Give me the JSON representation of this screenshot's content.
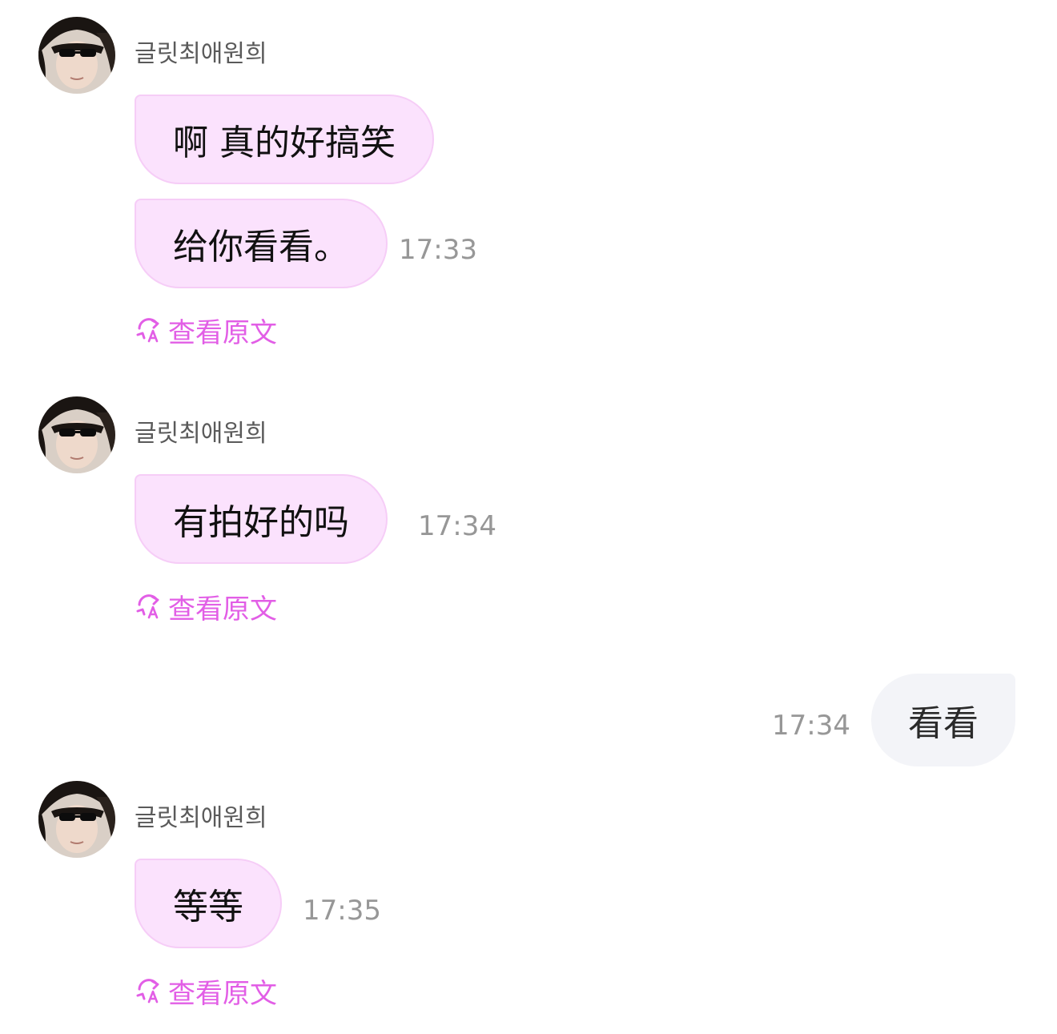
{
  "colors": {
    "incoming_bubble": "#fbe2fd",
    "incoming_border": "#f6cdf7",
    "outgoing_bubble": "#f3f4f8",
    "translate_link": "#e25ee6",
    "timestamp": "#979797"
  },
  "groups": [
    {
      "sender": "글릿최애원희",
      "messages": [
        "啊 真的好搞笑",
        "给你看看。"
      ],
      "time": "17:33",
      "translate_label": "查看原文",
      "translate_icon": "translate-icon"
    },
    {
      "sender": "글릿최애원희",
      "messages": [
        "有拍好的吗"
      ],
      "time": "17:34",
      "translate_label": "查看原文",
      "translate_icon": "translate-icon"
    },
    {
      "sender": "글릿최애원희",
      "messages": [
        "等等"
      ],
      "time": "17:35",
      "translate_label": "查看原文",
      "translate_icon": "translate-icon"
    }
  ],
  "outgoing": {
    "message": "看看",
    "time": "17:34"
  }
}
